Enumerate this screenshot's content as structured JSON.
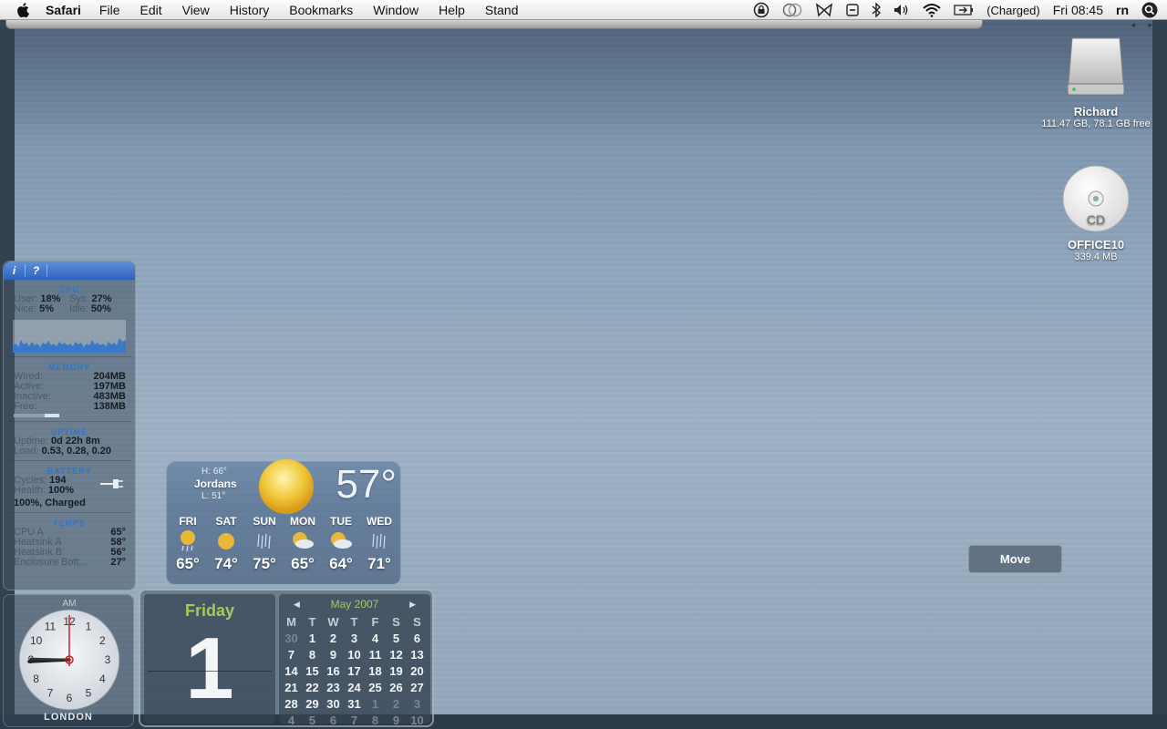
{
  "menubar": {
    "app_name": "Safari",
    "menus": [
      "File",
      "Edit",
      "View",
      "History",
      "Bookmarks",
      "Window",
      "Help",
      "Stand"
    ],
    "battery_status": "(Charged)",
    "clock": "Fri 08:45",
    "user": "rn"
  },
  "desktop": {
    "disk": {
      "name": "Richard",
      "info": "111.47 GB, 78.1 GB free"
    },
    "cd": {
      "name": "OFFICE10",
      "info": "339.4 MB",
      "label": "CD"
    }
  },
  "istat": {
    "info_label": "i",
    "help_label": "?",
    "cpu": {
      "title": "CPU",
      "user_label": "User:",
      "user": "18%",
      "sys_label": "Sys:",
      "sys": "27%",
      "nice_label": "Nice:",
      "nice": "5%",
      "idle_label": "Idle:",
      "idle": "50%"
    },
    "memory": {
      "title": "MEMORY",
      "rows": [
        {
          "label": "Wired:",
          "value": "204MB"
        },
        {
          "label": "Active:",
          "value": "197MB"
        },
        {
          "label": "Inactive:",
          "value": "483MB"
        },
        {
          "label": "Free:",
          "value": "138MB"
        }
      ],
      "used_fraction": 0.67
    },
    "uptime": {
      "title": "UPTIME",
      "uptime_label": "Uptime:",
      "uptime": "0d 22h 8m",
      "load_label": "Load:",
      "load": "0.53, 0.28, 0.20"
    },
    "battery": {
      "title": "BATTERY",
      "cycles_label": "Cycles:",
      "cycles": "194",
      "health_label": "Health:",
      "health": "100%",
      "status": "100%, Charged"
    },
    "temps": {
      "title": "TEMPS",
      "rows": [
        {
          "label": "CPU A",
          "value": "65°"
        },
        {
          "label": "Heatsink A",
          "value": "58°"
        },
        {
          "label": "Heatsink B",
          "value": "56°"
        },
        {
          "label": "Enclosure Bott...",
          "value": "27°"
        }
      ]
    }
  },
  "clock_widget": {
    "ampm": "AM",
    "city": "LONDON",
    "numbers": [
      "12",
      "1",
      "2",
      "3",
      "4",
      "5",
      "6",
      "7",
      "8",
      "9",
      "10",
      "11"
    ]
  },
  "weather": {
    "high": "H: 66°",
    "location": "Jordans",
    "low": "L: 51°",
    "current_temp": "57°",
    "forecast": [
      {
        "day": "FRI",
        "temp": "65°",
        "icon": "sun-rain-icon"
      },
      {
        "day": "SAT",
        "temp": "74°",
        "icon": "sun-icon"
      },
      {
        "day": "SUN",
        "temp": "75°",
        "icon": "rain-icon"
      },
      {
        "day": "MON",
        "temp": "65°",
        "icon": "partly-cloudy-icon"
      },
      {
        "day": "TUE",
        "temp": "64°",
        "icon": "partly-cloudy-icon"
      },
      {
        "day": "WED",
        "temp": "71°",
        "icon": "rain-icon"
      }
    ]
  },
  "calendar": {
    "weekday": "Friday",
    "day": "1",
    "month_label": "May 2007",
    "headers": [
      "M",
      "T",
      "W",
      "T",
      "F",
      "S",
      "S"
    ],
    "weeks": [
      [
        "30",
        "1",
        "2",
        "3",
        "4",
        "5",
        "6"
      ],
      [
        "7",
        "8",
        "9",
        "10",
        "11",
        "12",
        "13"
      ],
      [
        "14",
        "15",
        "16",
        "17",
        "18",
        "19",
        "20"
      ],
      [
        "21",
        "22",
        "23",
        "24",
        "25",
        "26",
        "27"
      ],
      [
        "28",
        "29",
        "30",
        "31",
        "1",
        "2",
        "3"
      ],
      [
        "4",
        "5",
        "6",
        "7",
        "8",
        "9",
        "10"
      ]
    ]
  },
  "move_button": {
    "label": "Move"
  },
  "colors": {
    "accent_green": "#a7c957",
    "istat_blue": "#2e76c8",
    "clock_hand": "#cc2222"
  }
}
